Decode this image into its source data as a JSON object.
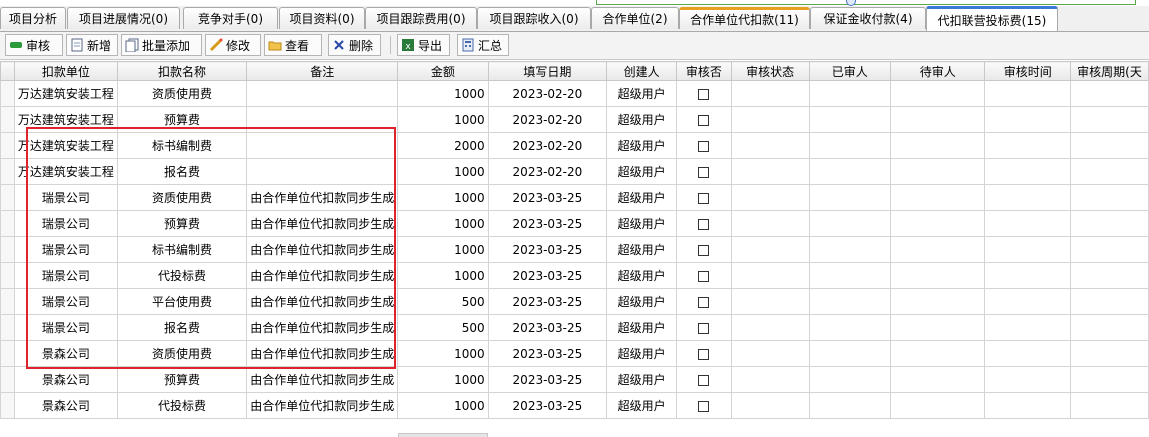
{
  "tabs": [
    {
      "label": "项目分析",
      "highlight": ""
    },
    {
      "label": "项目进展情况(0)",
      "highlight": ""
    },
    {
      "label": "竞争对手(0)",
      "highlight": ""
    },
    {
      "label": "项目资料(0)",
      "highlight": ""
    },
    {
      "label": "项目跟踪费用(0)",
      "highlight": ""
    },
    {
      "label": "项目跟踪收入(0)",
      "highlight": ""
    },
    {
      "label": "合作单位(2)",
      "highlight": ""
    },
    {
      "label": "合作单位代扣款(11)",
      "highlight": "orange"
    },
    {
      "label": "保证金收付款(4)",
      "highlight": ""
    },
    {
      "label": "代扣联营投标费(15)",
      "highlight": "blue",
      "active": true
    }
  ],
  "toolbar": {
    "approve": "审核",
    "add": "新增",
    "batch_add": "批量添加",
    "edit": "修改",
    "view": "查看",
    "delete": "删除",
    "export": "导出",
    "summary": "汇总"
  },
  "columns": [
    "扣款单位",
    "扣款名称",
    "备注",
    "金额",
    "填写日期",
    "创建人",
    "审核否",
    "审核状态",
    "已审人",
    "待审人",
    "审核时间",
    "审核周期(天"
  ],
  "rows": [
    {
      "unit": "万达建筑安装工程",
      "name": "资质使用费",
      "note": "",
      "amount": "1000",
      "date": "2023-02-20",
      "creator": "超级用户"
    },
    {
      "unit": "万达建筑安装工程",
      "name": "预算费",
      "note": "",
      "amount": "1000",
      "date": "2023-02-20",
      "creator": "超级用户"
    },
    {
      "unit": "万达建筑安装工程",
      "name": "标书编制费",
      "note": "",
      "amount": "2000",
      "date": "2023-02-20",
      "creator": "超级用户"
    },
    {
      "unit": "万达建筑安装工程",
      "name": "报名费",
      "note": "",
      "amount": "1000",
      "date": "2023-02-20",
      "creator": "超级用户"
    },
    {
      "unit": "瑞景公司",
      "name": "资质使用费",
      "note": "由合作单位代扣款同步生成",
      "amount": "1000",
      "date": "2023-03-25",
      "creator": "超级用户"
    },
    {
      "unit": "瑞景公司",
      "name": "预算费",
      "note": "由合作单位代扣款同步生成",
      "amount": "1000",
      "date": "2023-03-25",
      "creator": "超级用户"
    },
    {
      "unit": "瑞景公司",
      "name": "标书编制费",
      "note": "由合作单位代扣款同步生成",
      "amount": "1000",
      "date": "2023-03-25",
      "creator": "超级用户"
    },
    {
      "unit": "瑞景公司",
      "name": "代投标费",
      "note": "由合作单位代扣款同步生成",
      "amount": "1000",
      "date": "2023-03-25",
      "creator": "超级用户"
    },
    {
      "unit": "瑞景公司",
      "name": "平台使用费",
      "note": "由合作单位代扣款同步生成",
      "amount": "500",
      "date": "2023-03-25",
      "creator": "超级用户"
    },
    {
      "unit": "瑞景公司",
      "name": "报名费",
      "note": "由合作单位代扣款同步生成",
      "amount": "500",
      "date": "2023-03-25",
      "creator": "超级用户"
    },
    {
      "unit": "景森公司",
      "name": "资质使用费",
      "note": "由合作单位代扣款同步生成",
      "amount": "1000",
      "date": "2023-03-25",
      "creator": "超级用户"
    },
    {
      "unit": "景森公司",
      "name": "预算费",
      "note": "由合作单位代扣款同步生成",
      "amount": "1000",
      "date": "2023-03-25",
      "creator": "超级用户"
    },
    {
      "unit": "景森公司",
      "name": "代投标费",
      "note": "由合作单位代扣款同步生成",
      "amount": "1000",
      "date": "2023-03-25",
      "creator": "超级用户"
    }
  ],
  "colors": {
    "highlight_box": "#e0232a",
    "tab_orange": "#e8a020",
    "tab_blue": "#3a7ad8"
  }
}
